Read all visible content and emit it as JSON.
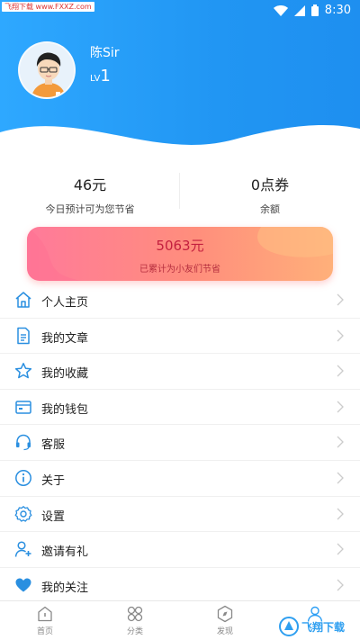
{
  "status_bar": {
    "watermark": "飞翔下载 www.FXXZ.com",
    "time": "8:30"
  },
  "profile": {
    "name": "陈Sir",
    "level_prefix": "LV",
    "level_value": "1"
  },
  "stats": [
    {
      "value": "46元",
      "label": "今日预计可为您节省"
    },
    {
      "value": "0点券",
      "label": "余额"
    }
  ],
  "savings_card": {
    "amount": "5063元",
    "description": "已累计为小友们节省"
  },
  "menu": [
    {
      "label": "个人主页",
      "icon": "home-icon"
    },
    {
      "label": "我的文章",
      "icon": "document-icon"
    },
    {
      "label": "我的收藏",
      "icon": "star-icon"
    },
    {
      "label": "我的钱包",
      "icon": "wallet-icon"
    },
    {
      "label": "客服",
      "icon": "headset-icon"
    },
    {
      "label": "关于",
      "icon": "info-icon"
    },
    {
      "label": "设置",
      "icon": "gear-icon"
    },
    {
      "label": "邀请有礼",
      "icon": "add-user-icon"
    },
    {
      "label": "我的关注",
      "icon": "heart-icon"
    }
  ],
  "tabbar": [
    {
      "label": "首页",
      "icon": "home-tab-icon"
    },
    {
      "label": "分类",
      "icon": "category-icon"
    },
    {
      "label": "发现",
      "icon": "discover-icon"
    },
    {
      "label": "",
      "icon": "profile-icon"
    }
  ],
  "bottom_watermark": "飞翔下载",
  "colors": {
    "accent": "#2196f3",
    "icon_blue": "#2a8fe0",
    "card_start": "#ff7a9a",
    "card_end": "#ffb07a",
    "card_text": "#c4203f"
  }
}
